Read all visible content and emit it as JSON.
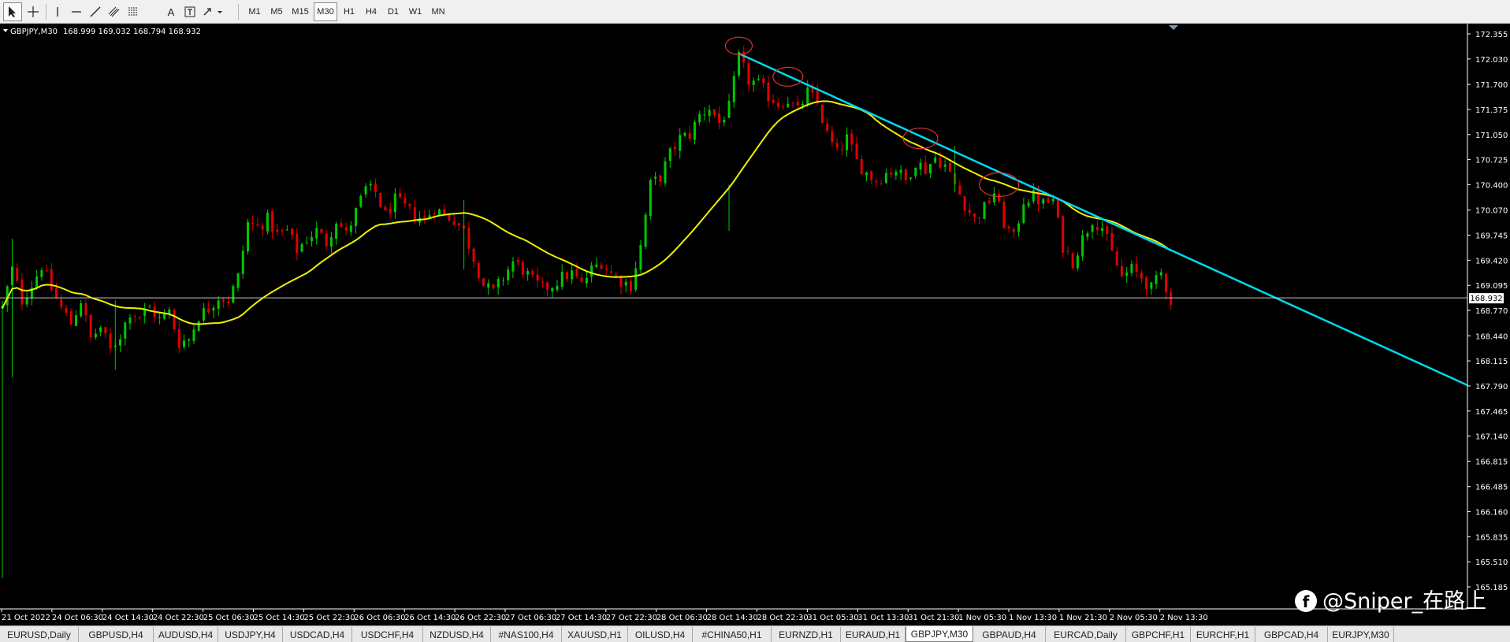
{
  "toolbar": {
    "tools": [
      {
        "name": "cursor-icon"
      },
      {
        "name": "crosshair-icon"
      },
      {
        "name": "vertical-line-icon"
      },
      {
        "name": "horizontal-line-icon"
      },
      {
        "name": "trendline-icon"
      },
      {
        "name": "equidistant-channel-icon"
      },
      {
        "name": "fibonacci-icon"
      },
      {
        "name": "text-icon"
      },
      {
        "name": "text-label-icon"
      },
      {
        "name": "arrows-icon"
      }
    ],
    "timeframes": [
      "M1",
      "M5",
      "M15",
      "M30",
      "H1",
      "H4",
      "D1",
      "W1",
      "MN"
    ],
    "active_timeframe": "M30"
  },
  "chart": {
    "header": "GBPJPY,M30",
    "ohlc": "168.999 169.032 168.794 168.932",
    "current_price": "168.932",
    "watermark": "@Sniper_在路上",
    "colors": {
      "background": "#000000",
      "bull": "#00c800",
      "bear": "#e00000",
      "ma": "#f0f000",
      "trendline": "#00d8f0",
      "highlight": "#e03030",
      "axis_text": "#ffffff"
    }
  },
  "chart_data": {
    "type": "candlestick",
    "symbol": "GBPJPY",
    "timeframe": "M30",
    "y_ticks": [
      "172.355",
      "172.030",
      "171.700",
      "171.375",
      "171.050",
      "170.725",
      "170.400",
      "170.070",
      "169.745",
      "169.420",
      "169.095",
      "168.770",
      "168.440",
      "168.115",
      "167.790",
      "167.465",
      "167.140",
      "166.815",
      "166.485",
      "166.160",
      "165.835",
      "165.510",
      "165.185"
    ],
    "x_ticks": [
      "21 Oct 2022",
      "24 Oct 06:30",
      "24 Oct 14:30",
      "24 Oct 22:30",
      "25 Oct 06:30",
      "25 Oct 14:30",
      "25 Oct 22:30",
      "26 Oct 06:30",
      "26 Oct 14:30",
      "26 Oct 22:30",
      "27 Oct 06:30",
      "27 Oct 14:30",
      "27 Oct 22:30",
      "28 Oct 06:30",
      "28 Oct 14:30",
      "28 Oct 22:30",
      "31 Oct 05:30",
      "31 Oct 13:30",
      "31 Oct 21:30",
      "1 Nov 05:30",
      "1 Nov 13:30",
      "1 Nov 21:30",
      "2 Nov 05:30",
      "2 Nov 13:30"
    ],
    "ylim": [
      165.185,
      172.355
    ],
    "current_price": 168.932,
    "price_path": [
      [
        0,
        168.8
      ],
      [
        2,
        169.3
      ],
      [
        4,
        168.9
      ],
      [
        6,
        169.1
      ],
      [
        8,
        169.35
      ],
      [
        10,
        169.05
      ],
      [
        12,
        168.8
      ],
      [
        14,
        168.6
      ],
      [
        16,
        168.9
      ],
      [
        18,
        168.4
      ],
      [
        20,
        168.55
      ],
      [
        22,
        168.25
      ],
      [
        24,
        168.45
      ],
      [
        26,
        168.75
      ],
      [
        28,
        168.7
      ],
      [
        30,
        168.8
      ],
      [
        32,
        168.65
      ],
      [
        34,
        168.75
      ],
      [
        36,
        168.35
      ],
      [
        38,
        168.4
      ],
      [
        40,
        168.7
      ],
      [
        42,
        168.8
      ],
      [
        44,
        168.95
      ],
      [
        46,
        168.9
      ],
      [
        48,
        169.2
      ],
      [
        50,
        169.9
      ],
      [
        52,
        169.85
      ],
      [
        54,
        169.95
      ],
      [
        56,
        169.75
      ],
      [
        58,
        169.8
      ],
      [
        60,
        169.55
      ],
      [
        62,
        169.7
      ],
      [
        64,
        169.8
      ],
      [
        66,
        169.65
      ],
      [
        68,
        169.95
      ],
      [
        70,
        169.75
      ],
      [
        72,
        170.05
      ],
      [
        74,
        170.35
      ],
      [
        76,
        170.3
      ],
      [
        78,
        170.0
      ],
      [
        80,
        170.2
      ],
      [
        82,
        170.1
      ],
      [
        84,
        170.0
      ],
      [
        86,
        169.95
      ],
      [
        88,
        170.1
      ],
      [
        90,
        170.0
      ],
      [
        92,
        169.95
      ],
      [
        94,
        169.8
      ],
      [
        96,
        169.45
      ],
      [
        98,
        169.1
      ],
      [
        100,
        169.0
      ],
      [
        102,
        169.2
      ],
      [
        104,
        169.4
      ],
      [
        106,
        169.3
      ],
      [
        108,
        169.15
      ],
      [
        110,
        169.05
      ],
      [
        112,
        169.1
      ],
      [
        114,
        169.2
      ],
      [
        116,
        169.25
      ],
      [
        118,
        169.1
      ],
      [
        120,
        169.3
      ],
      [
        122,
        169.4
      ],
      [
        124,
        169.25
      ],
      [
        126,
        169.15
      ],
      [
        128,
        169.1
      ],
      [
        130,
        169.6
      ],
      [
        132,
        170.4
      ],
      [
        134,
        170.5
      ],
      [
        136,
        170.8
      ],
      [
        138,
        171.0
      ],
      [
        140,
        171.05
      ],
      [
        142,
        171.3
      ],
      [
        144,
        171.4
      ],
      [
        146,
        171.2
      ],
      [
        148,
        171.4
      ],
      [
        150,
        172.05
      ],
      [
        152,
        171.75
      ],
      [
        154,
        171.7
      ],
      [
        156,
        171.55
      ],
      [
        158,
        171.45
      ],
      [
        160,
        171.5
      ],
      [
        162,
        171.35
      ],
      [
        164,
        171.6
      ],
      [
        166,
        171.45
      ],
      [
        168,
        171.05
      ],
      [
        170,
        170.8
      ],
      [
        172,
        171.0
      ],
      [
        174,
        170.7
      ],
      [
        176,
        170.55
      ],
      [
        178,
        170.45
      ],
      [
        180,
        170.55
      ],
      [
        182,
        170.6
      ],
      [
        184,
        170.45
      ],
      [
        186,
        170.7
      ],
      [
        188,
        170.6
      ],
      [
        190,
        170.75
      ],
      [
        192,
        170.65
      ],
      [
        194,
        170.4
      ],
      [
        196,
        170.15
      ],
      [
        198,
        169.95
      ],
      [
        200,
        170.1
      ],
      [
        202,
        170.3
      ],
      [
        204,
        169.9
      ],
      [
        206,
        169.7
      ],
      [
        208,
        170.2
      ],
      [
        210,
        170.25
      ],
      [
        212,
        170.15
      ],
      [
        214,
        170.2
      ],
      [
        216,
        169.6
      ],
      [
        218,
        169.4
      ],
      [
        220,
        169.7
      ],
      [
        222,
        169.95
      ],
      [
        224,
        169.85
      ],
      [
        226,
        169.5
      ],
      [
        228,
        169.2
      ],
      [
        230,
        169.3
      ],
      [
        232,
        169.2
      ],
      [
        234,
        169.05
      ],
      [
        236,
        169.25
      ],
      [
        238,
        168.9
      ]
    ],
    "annotations": [
      {
        "type": "trendline",
        "from": [
          "28 Oct 22:30",
          172.1
        ],
        "to": [
          "2 Nov 13:30+",
          167.8
        ]
      },
      {
        "type": "circle",
        "at": [
          "28 Oct 22:30",
          172.2
        ]
      },
      {
        "type": "circle",
        "at": [
          "31 Oct 05:30",
          171.8
        ]
      },
      {
        "type": "circle",
        "at": [
          "1 Nov 05:30",
          171.0
        ]
      },
      {
        "type": "circle",
        "at": [
          "1 Nov 21:30",
          170.4
        ]
      }
    ]
  },
  "tabs": [
    "EURUSD,Daily",
    "GBPUSD,H4",
    "AUDUSD,H4",
    "USDJPY,H4",
    "USDCAD,H4",
    "USDCHF,H4",
    "NZDUSD,H4",
    "#NAS100,H4",
    "XAUUSD,H1",
    "OILUSD,H4",
    "#CHINA50,H1",
    "EURNZD,H1",
    "EURAUD,H1",
    "GBPJPY,M30",
    "GBPAUD,H4",
    "EURCAD,Daily",
    "GBPCHF,H1",
    "EURCHF,H1",
    "GBPCAD,H4",
    "EURJPY,M30"
  ],
  "active_tab": "GBPJPY,M30"
}
